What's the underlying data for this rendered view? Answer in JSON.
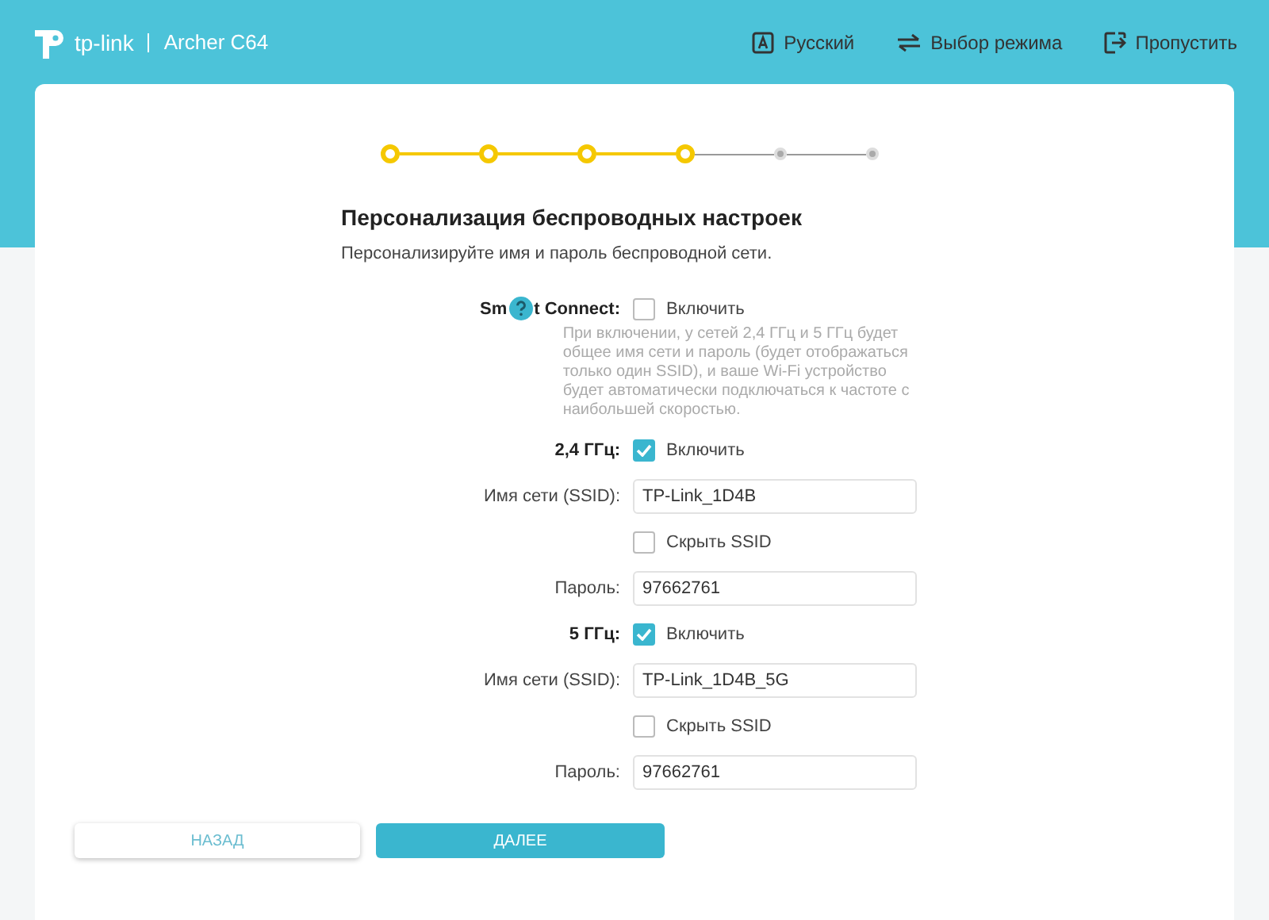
{
  "header": {
    "brand": "tp-link",
    "model": "Archer C64",
    "actions": [
      {
        "kind": "language",
        "label": "Русский"
      },
      {
        "kind": "mode",
        "label": "Выбор режима"
      },
      {
        "kind": "skip",
        "label": "Пропустить"
      }
    ]
  },
  "steps": [
    {
      "completed": true
    },
    {
      "completed": true
    },
    {
      "completed": true
    },
    {
      "completed": true
    },
    {
      "completed": false
    },
    {
      "completed": false
    }
  ],
  "title": "Персонализация беспроводных настроек",
  "subtitle": "Персонализируйте имя и пароль беспроводной сети.",
  "smart_connect": {
    "label_start": "Sm",
    "label_end": "t Connect:",
    "checkbox": {
      "label": "Включить",
      "checked": false
    },
    "note": "При включении, у сетей 2,4 ГГц и 5 ГГц будет общее имя сети и пароль (будет отображаться только один SSID), и ваше Wi-Fi устройство будет автоматически подключаться к частоте с наибольшей скоростью."
  },
  "bands": [
    {
      "label": "2,4 ГГц:",
      "enable": {
        "label": "Включить",
        "checked": true
      },
      "ssid": {
        "label": "Имя сети (SSID):",
        "value": "TP-Link_1D4B"
      },
      "hide": {
        "label": "Скрыть SSID",
        "checked": false
      },
      "password": {
        "label": "Пароль:",
        "value": "97662761"
      }
    },
    {
      "label": "5 ГГц:",
      "enable": {
        "label": "Включить",
        "checked": true
      },
      "ssid": {
        "label": "Имя сети (SSID):",
        "value": "TP-Link_1D4B_5G"
      },
      "hide": {
        "label": "Скрыть SSID",
        "checked": false
      },
      "password": {
        "label": "Пароль:",
        "value": "97662761"
      }
    }
  ],
  "buttons": {
    "back": "НАЗАД",
    "next": "ДАЛЕЕ"
  }
}
